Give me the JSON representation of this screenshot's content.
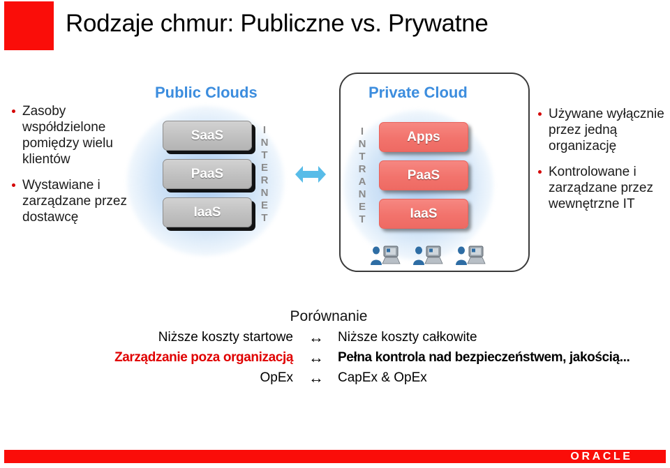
{
  "slide": {
    "title": "Rodzaje chmur: Publiczne vs. Prywatne",
    "accent_red": "#FA0D09",
    "heading_blue": "#3C8DDE",
    "highlight_red": "#E00000"
  },
  "bullets_left": [
    {
      "text": "Zasoby współdzielone pomiędzy wielu klientów"
    },
    {
      "text": "Wystawiane i zarządzane przez dostawcę"
    }
  ],
  "bullets_right": [
    {
      "text": "Używane wyłącznie przez jedną organizację"
    },
    {
      "text": "Kontrolowane i zarządzane przez wewnętrzne  IT"
    }
  ],
  "public_cloud": {
    "heading": "Public Clouds",
    "network_label": "INTERNET",
    "layers": [
      "SaaS",
      "PaaS",
      "IaaS"
    ]
  },
  "private_cloud": {
    "heading": "Private Cloud",
    "network_label": "INTRANET",
    "layers": [
      "Apps",
      "PaaS",
      "IaaS"
    ],
    "user_count": 3
  },
  "exchange_arrow": "double-arrow-horizontal",
  "comparison": {
    "title": "Porównanie",
    "arrow": "↔",
    "rows": [
      {
        "left": "Niższe koszty startowe",
        "right": "Niższe koszty całkowite",
        "highlight": false
      },
      {
        "left": "Zarządzanie poza organizacją",
        "right": "Pełna kontrola nad bezpieczeństwem, jakością...",
        "highlight": true
      },
      {
        "left": "OpEx",
        "right": "CapEx & OpEx",
        "highlight": false
      }
    ]
  },
  "footer": {
    "logo_text": "ORACLE"
  }
}
